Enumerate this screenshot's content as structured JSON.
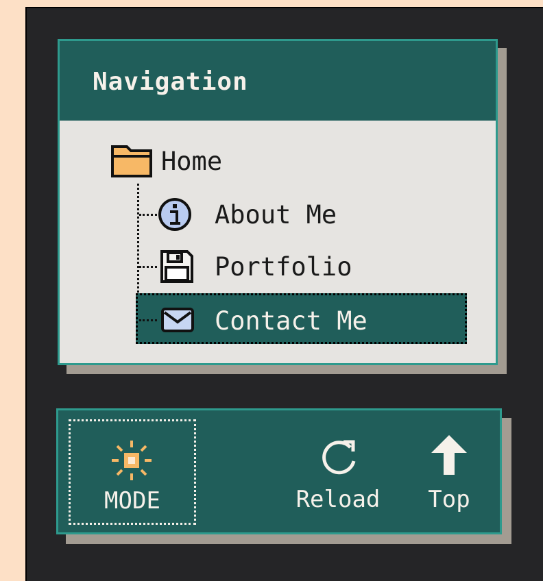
{
  "nav": {
    "title": "Navigation",
    "items": [
      {
        "label": "Home",
        "icon": "folder-icon"
      },
      {
        "label": "About Me",
        "icon": "info-icon"
      },
      {
        "label": "Portfolio",
        "icon": "floppy-disk-icon"
      },
      {
        "label": "Contact Me",
        "icon": "envelope-icon",
        "selected": true
      }
    ]
  },
  "toolbar": {
    "mode_label": "MODE",
    "reload_label": "Reload",
    "top_label": "Top",
    "mode_icon": "sun-icon",
    "reload_icon": "reload-icon",
    "top_icon": "arrow-up-icon"
  },
  "colors": {
    "page_background": "#fde0c6",
    "panel_background": "#252527",
    "titlebar": "#205e5a",
    "border_accent": "#2e9a8d",
    "window_body": "#e6e4e1",
    "shadow": "#a39c92",
    "folder": "#f7b866",
    "info_icon_fill": "#b9cbf0"
  }
}
